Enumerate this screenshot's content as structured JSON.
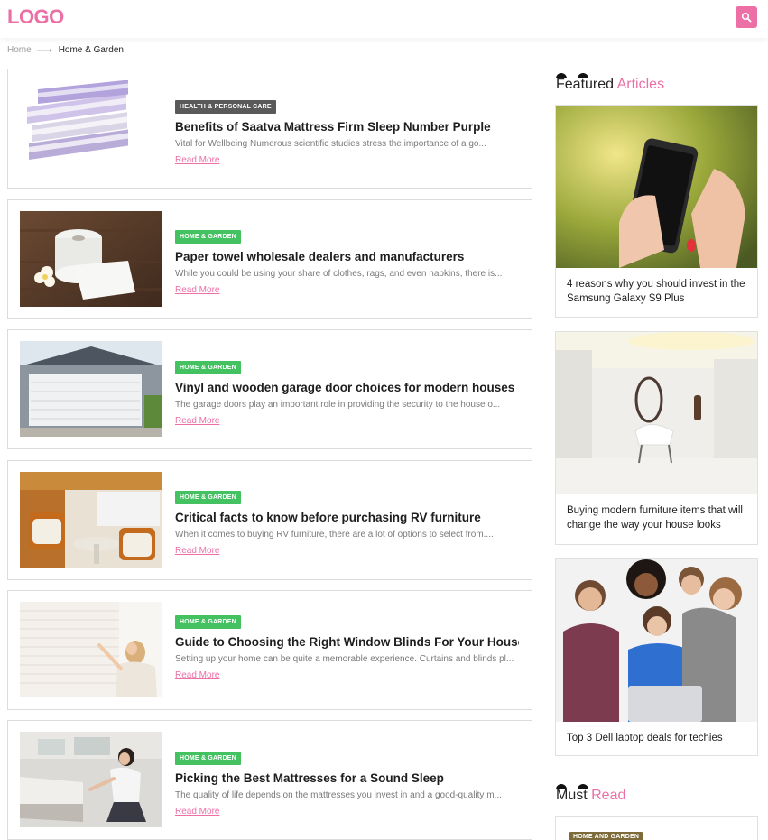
{
  "header": {
    "logo": "LOGO",
    "search_icon": "search-icon"
  },
  "breadcrumb": {
    "home": "Home",
    "current": "Home & Garden"
  },
  "colors": {
    "accent": "#ec6fa6",
    "health_badge": "#5a5a5a",
    "home_badge": "#44c262",
    "must_badge": "#7d6b3a"
  },
  "articles": [
    {
      "badge": "HEALTH & PERSONAL CARE",
      "title": "Benefits of Saatva Mattress Firm Sleep Number Purple",
      "excerpt": "Vital for Wellbeing Numerous scientific studies stress the importance of a go...",
      "read_more": "Read More"
    },
    {
      "badge": "HOME & GARDEN",
      "title": "Paper towel wholesale dealers and manufacturers",
      "excerpt": "While you could be using your share of clothes, rags, and even napkins, there is...",
      "read_more": "Read More"
    },
    {
      "badge": "HOME & GARDEN",
      "title": "Vinyl and wooden garage door choices for modern houses",
      "excerpt": "The garage doors play an important role in providing the security to the house o...",
      "read_more": "Read More"
    },
    {
      "badge": "HOME & GARDEN",
      "title": "Critical facts to know before purchasing RV furniture",
      "excerpt": "When it comes to buying RV furniture, there are a lot of options to select from....",
      "read_more": "Read More"
    },
    {
      "badge": "HOME & GARDEN",
      "title": "Guide to Choosing the Right Window Blinds For Your House",
      "excerpt": "Setting up your home can be quite a memorable experience. Curtains and blinds pl...",
      "read_more": "Read More"
    },
    {
      "badge": "HOME & GARDEN",
      "title": "Picking the Best Mattresses for a Sound Sleep",
      "excerpt": "The quality of life depends on the mattresses you invest in and a good-quality m...",
      "read_more": "Read More"
    }
  ],
  "featured": {
    "heading_plain": "Featured",
    "heading_accent": "Articles",
    "items": [
      {
        "caption": "4 reasons why you should invest in the Samsung Galaxy S9 Plus"
      },
      {
        "caption": "Buying modern furniture items that will change the way your house looks"
      },
      {
        "caption": "Top 3 Dell laptop deals for techies"
      }
    ]
  },
  "must_read": {
    "heading_plain": "Must",
    "heading_accent": "Read",
    "badge": "HOME AND GARDEN"
  }
}
